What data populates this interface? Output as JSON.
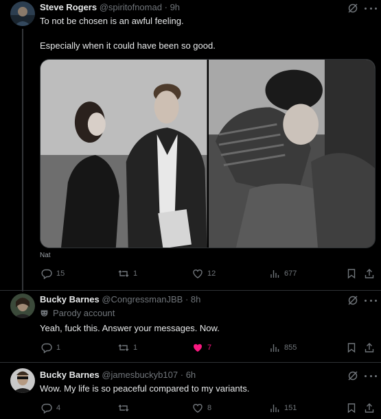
{
  "posts": [
    {
      "name": "Steve Rogers",
      "handle": "@spiritofnomad",
      "sep": "·",
      "time": "9h",
      "line1": "To not be chosen is an awful feeling.",
      "line2": "Especially when it could have been so good.",
      "alt_label": "Nat",
      "replies": "15",
      "reposts": "1",
      "likes": "12",
      "views": "677"
    },
    {
      "name": "Bucky Barnes",
      "handle": "@CongressmanJBB",
      "sep": "·",
      "time": "8h",
      "badge": "Parody account",
      "line1": "Yeah, fuck this. Answer your messages. Now.",
      "replies": "1",
      "reposts": "1",
      "likes": "7",
      "views": "855"
    },
    {
      "name": "Bucky Barnes",
      "handle": "@jamesbuckyb107",
      "sep": "·",
      "time": "6h",
      "line1": "Wow. My life is so peaceful compared to my variants.",
      "replies": "4",
      "reposts": "",
      "likes": "8",
      "views": "151"
    }
  ],
  "colors": {
    "like_active": "#f91880",
    "muted": "#71767b",
    "background": "#000000"
  },
  "icons": [
    "grok-icon",
    "more-icon",
    "reply-icon",
    "repost-icon",
    "like-icon",
    "views-icon",
    "bookmark-icon",
    "share-icon",
    "parody-mask-icon"
  ]
}
